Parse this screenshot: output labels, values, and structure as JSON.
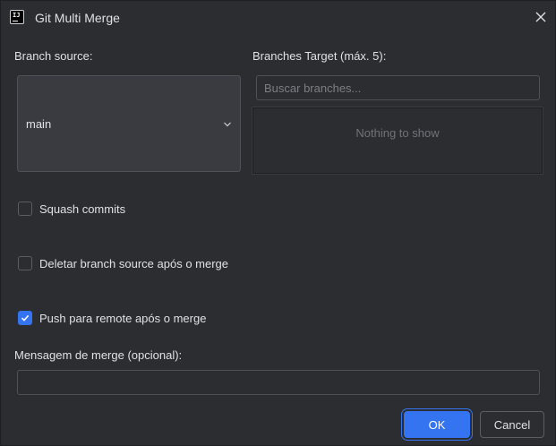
{
  "window": {
    "title": "Git Multi Merge",
    "app_icon": "intellij-icon",
    "close_icon": "close-icon"
  },
  "source": {
    "label": "Branch source:",
    "selected": "main",
    "dropdown_icon": "chevron-down-icon"
  },
  "target": {
    "label": "Branches Target (máx. 5):",
    "search_placeholder": "Buscar branches...",
    "search_value": "",
    "empty_text": "Nothing to show"
  },
  "options": {
    "squash": {
      "label": "Squash commits",
      "checked": false
    },
    "delete_source": {
      "label": "Deletar branch source após o merge",
      "checked": false
    },
    "push_remote": {
      "label": "Push para remote após o merge",
      "checked": true
    }
  },
  "message": {
    "label": "Mensagem de merge (opcional):",
    "value": ""
  },
  "buttons": {
    "ok": "OK",
    "cancel": "Cancel"
  },
  "colors": {
    "background": "#2b2d30",
    "accent": "#3574f0",
    "text": "#dfe1e5",
    "muted": "#6f737a"
  }
}
